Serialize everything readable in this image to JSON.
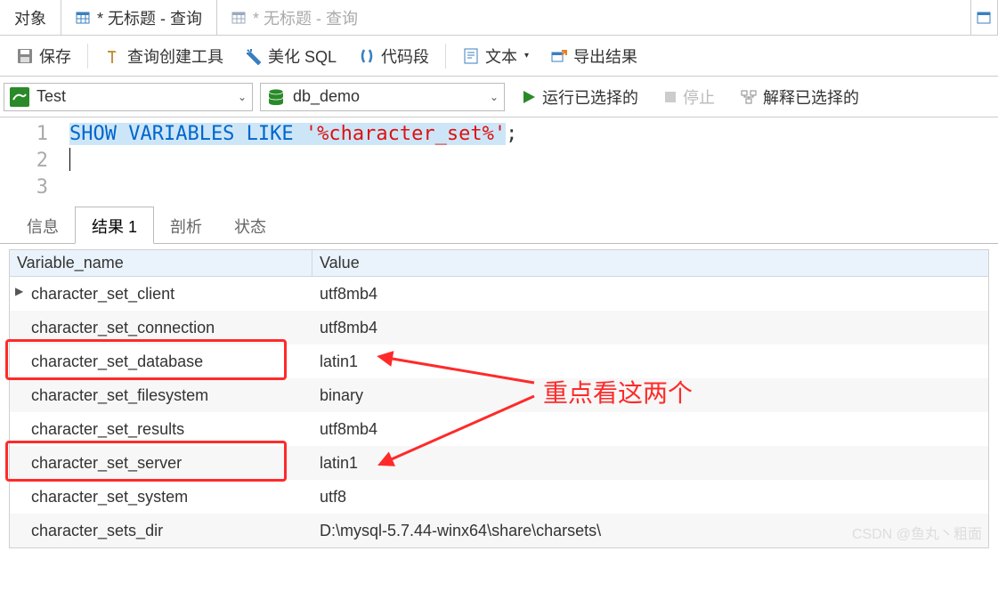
{
  "tabs": {
    "objects": "对象",
    "query1": "* 无标题 - 查询",
    "query2": "* 无标题 - 查询"
  },
  "toolbar": {
    "save": "保存",
    "builder": "查询创建工具",
    "beautify": "美化 SQL",
    "snippet": "代码段",
    "text": "文本",
    "export": "导出结果"
  },
  "conn": {
    "test": "Test",
    "db": "db_demo",
    "run": "运行已选择的",
    "stop": "停止",
    "explain": "解释已选择的"
  },
  "editor": {
    "line1_kw": "SHOW VARIABLES LIKE ",
    "line1_str": "'%character_set%'",
    "line1_end": ";"
  },
  "result_tabs": {
    "info": "信息",
    "result": "结果 1",
    "profile": "剖析",
    "status": "状态"
  },
  "grid": {
    "col1": "Variable_name",
    "col2": "Value",
    "rows": [
      {
        "name": "character_set_client",
        "value": "utf8mb4"
      },
      {
        "name": "character_set_connection",
        "value": "utf8mb4"
      },
      {
        "name": "character_set_database",
        "value": "latin1"
      },
      {
        "name": "character_set_filesystem",
        "value": "binary"
      },
      {
        "name": "character_set_results",
        "value": "utf8mb4"
      },
      {
        "name": "character_set_server",
        "value": "latin1"
      },
      {
        "name": "character_set_system",
        "value": "utf8"
      },
      {
        "name": "character_sets_dir",
        "value": "D:\\mysql-5.7.44-winx64\\share\\charsets\\"
      }
    ]
  },
  "annotation": "重点看这两个",
  "watermark": "CSDN @鱼丸丶粗面"
}
